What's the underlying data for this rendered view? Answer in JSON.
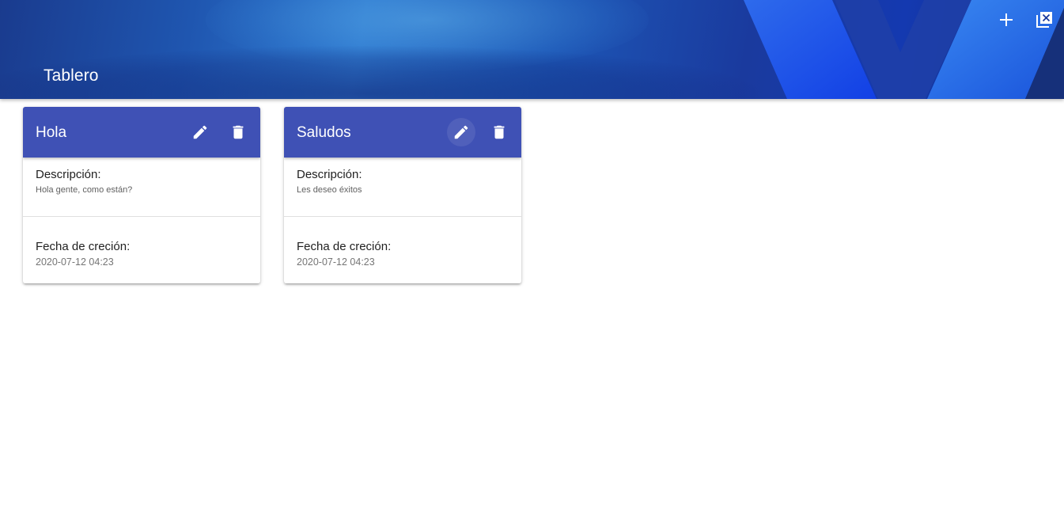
{
  "header": {
    "title": "Tablero",
    "actions": [
      {
        "icon": "plus-icon",
        "label": ""
      },
      {
        "icon": "close-all-icon",
        "label": ""
      }
    ]
  },
  "cards": [
    {
      "title": "Hola",
      "description_label": "Descripción:",
      "description": "Hola gente, como están?",
      "date_label": "Fecha de creción:",
      "date": "2020-07-12 04:23"
    },
    {
      "title": "Saludos",
      "description_label": "Descripción:",
      "description": "Les deseo éxitos",
      "date_label": "Fecha de creción:",
      "date": "2020-07-12 04:23"
    }
  ],
  "icons": {
    "edit": "pencil-icon",
    "delete": "trash-icon"
  },
  "colors": {
    "card_header": "#3f51b5",
    "banner_dark": "#16307a",
    "banner_light": "#2f7ad0"
  }
}
